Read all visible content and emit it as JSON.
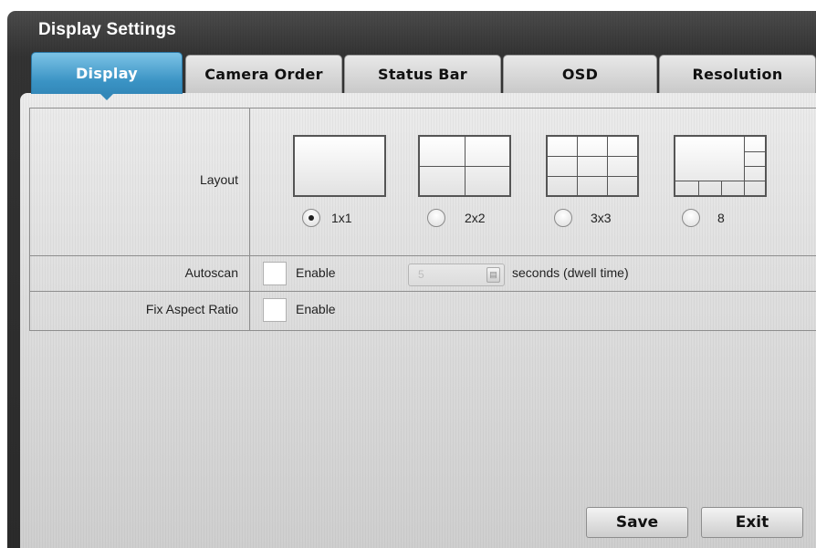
{
  "window": {
    "title": "Display Settings"
  },
  "tabs": [
    {
      "label": "Display",
      "active": true
    },
    {
      "label": "Camera Order",
      "active": false
    },
    {
      "label": "Status Bar",
      "active": false
    },
    {
      "label": "OSD",
      "active": false
    },
    {
      "label": "Resolution",
      "active": false
    }
  ],
  "layout": {
    "label": "Layout",
    "options": [
      {
        "label": "1x1",
        "selected": true
      },
      {
        "label": "2x2",
        "selected": false
      },
      {
        "label": "3x3",
        "selected": false
      },
      {
        "label": "8",
        "selected": false
      }
    ]
  },
  "autoscan": {
    "label": "Autoscan",
    "enable_label": "Enable",
    "enabled": false,
    "dwell_value": "5",
    "dwell_suffix": "seconds (dwell time)"
  },
  "aspect": {
    "label": "Fix Aspect Ratio",
    "enable_label": "Enable",
    "enabled": false
  },
  "buttons": {
    "save": "Save",
    "exit": "Exit"
  },
  "colors": {
    "active_tab": "#3a93c4",
    "window_frame": "#333333"
  }
}
